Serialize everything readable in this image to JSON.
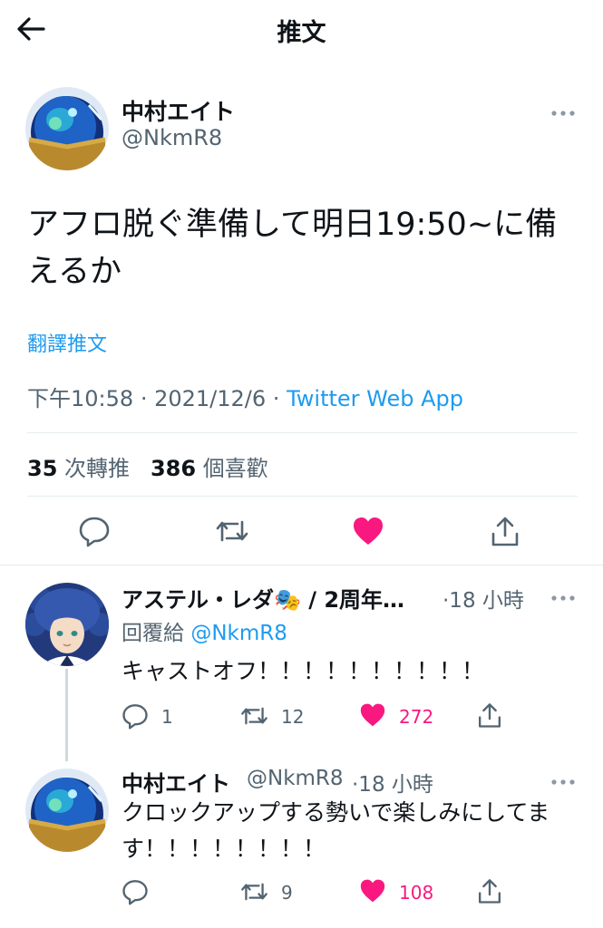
{
  "header": {
    "title": "推文"
  },
  "main_tweet": {
    "author_name": "中村エイト",
    "author_handle": "@NkmR8",
    "text": "アフロ脱ぐ準備して明日19:50~に備えるか",
    "translate_label": "翻譯推文",
    "time": "下午10:58",
    "date": "2021/12/6",
    "separator": "·",
    "app": "Twitter Web App",
    "retweet_count": "35",
    "retweet_label": "次轉推",
    "like_count": "386",
    "like_label": "個喜歡"
  },
  "replies": [
    {
      "author_name": "アステル・レダ🎭 / 2周年…",
      "time": "·18 小時",
      "replying_label": "回覆給",
      "replying_handle": "@NkmR8",
      "text": "キャストオフ！！！！！！！！！！",
      "reply_count": "1",
      "retweet_count": "12",
      "like_count": "272"
    },
    {
      "author_name": "中村エイト",
      "author_handle": "@NkmR8",
      "time": "·18 小時",
      "text": "クロックアップする勢いで楽しみにしてます！！！！！！！！",
      "reply_count": "",
      "retweet_count": "9",
      "like_count": "108"
    }
  ],
  "colors": {
    "accent": "#1d9bf0",
    "like": "#f91880",
    "secondary_text": "#536471",
    "divider": "#e6ecf0"
  },
  "icons": [
    "back-arrow-icon",
    "more-icon",
    "reply-icon",
    "retweet-icon",
    "heart-icon",
    "share-icon"
  ]
}
